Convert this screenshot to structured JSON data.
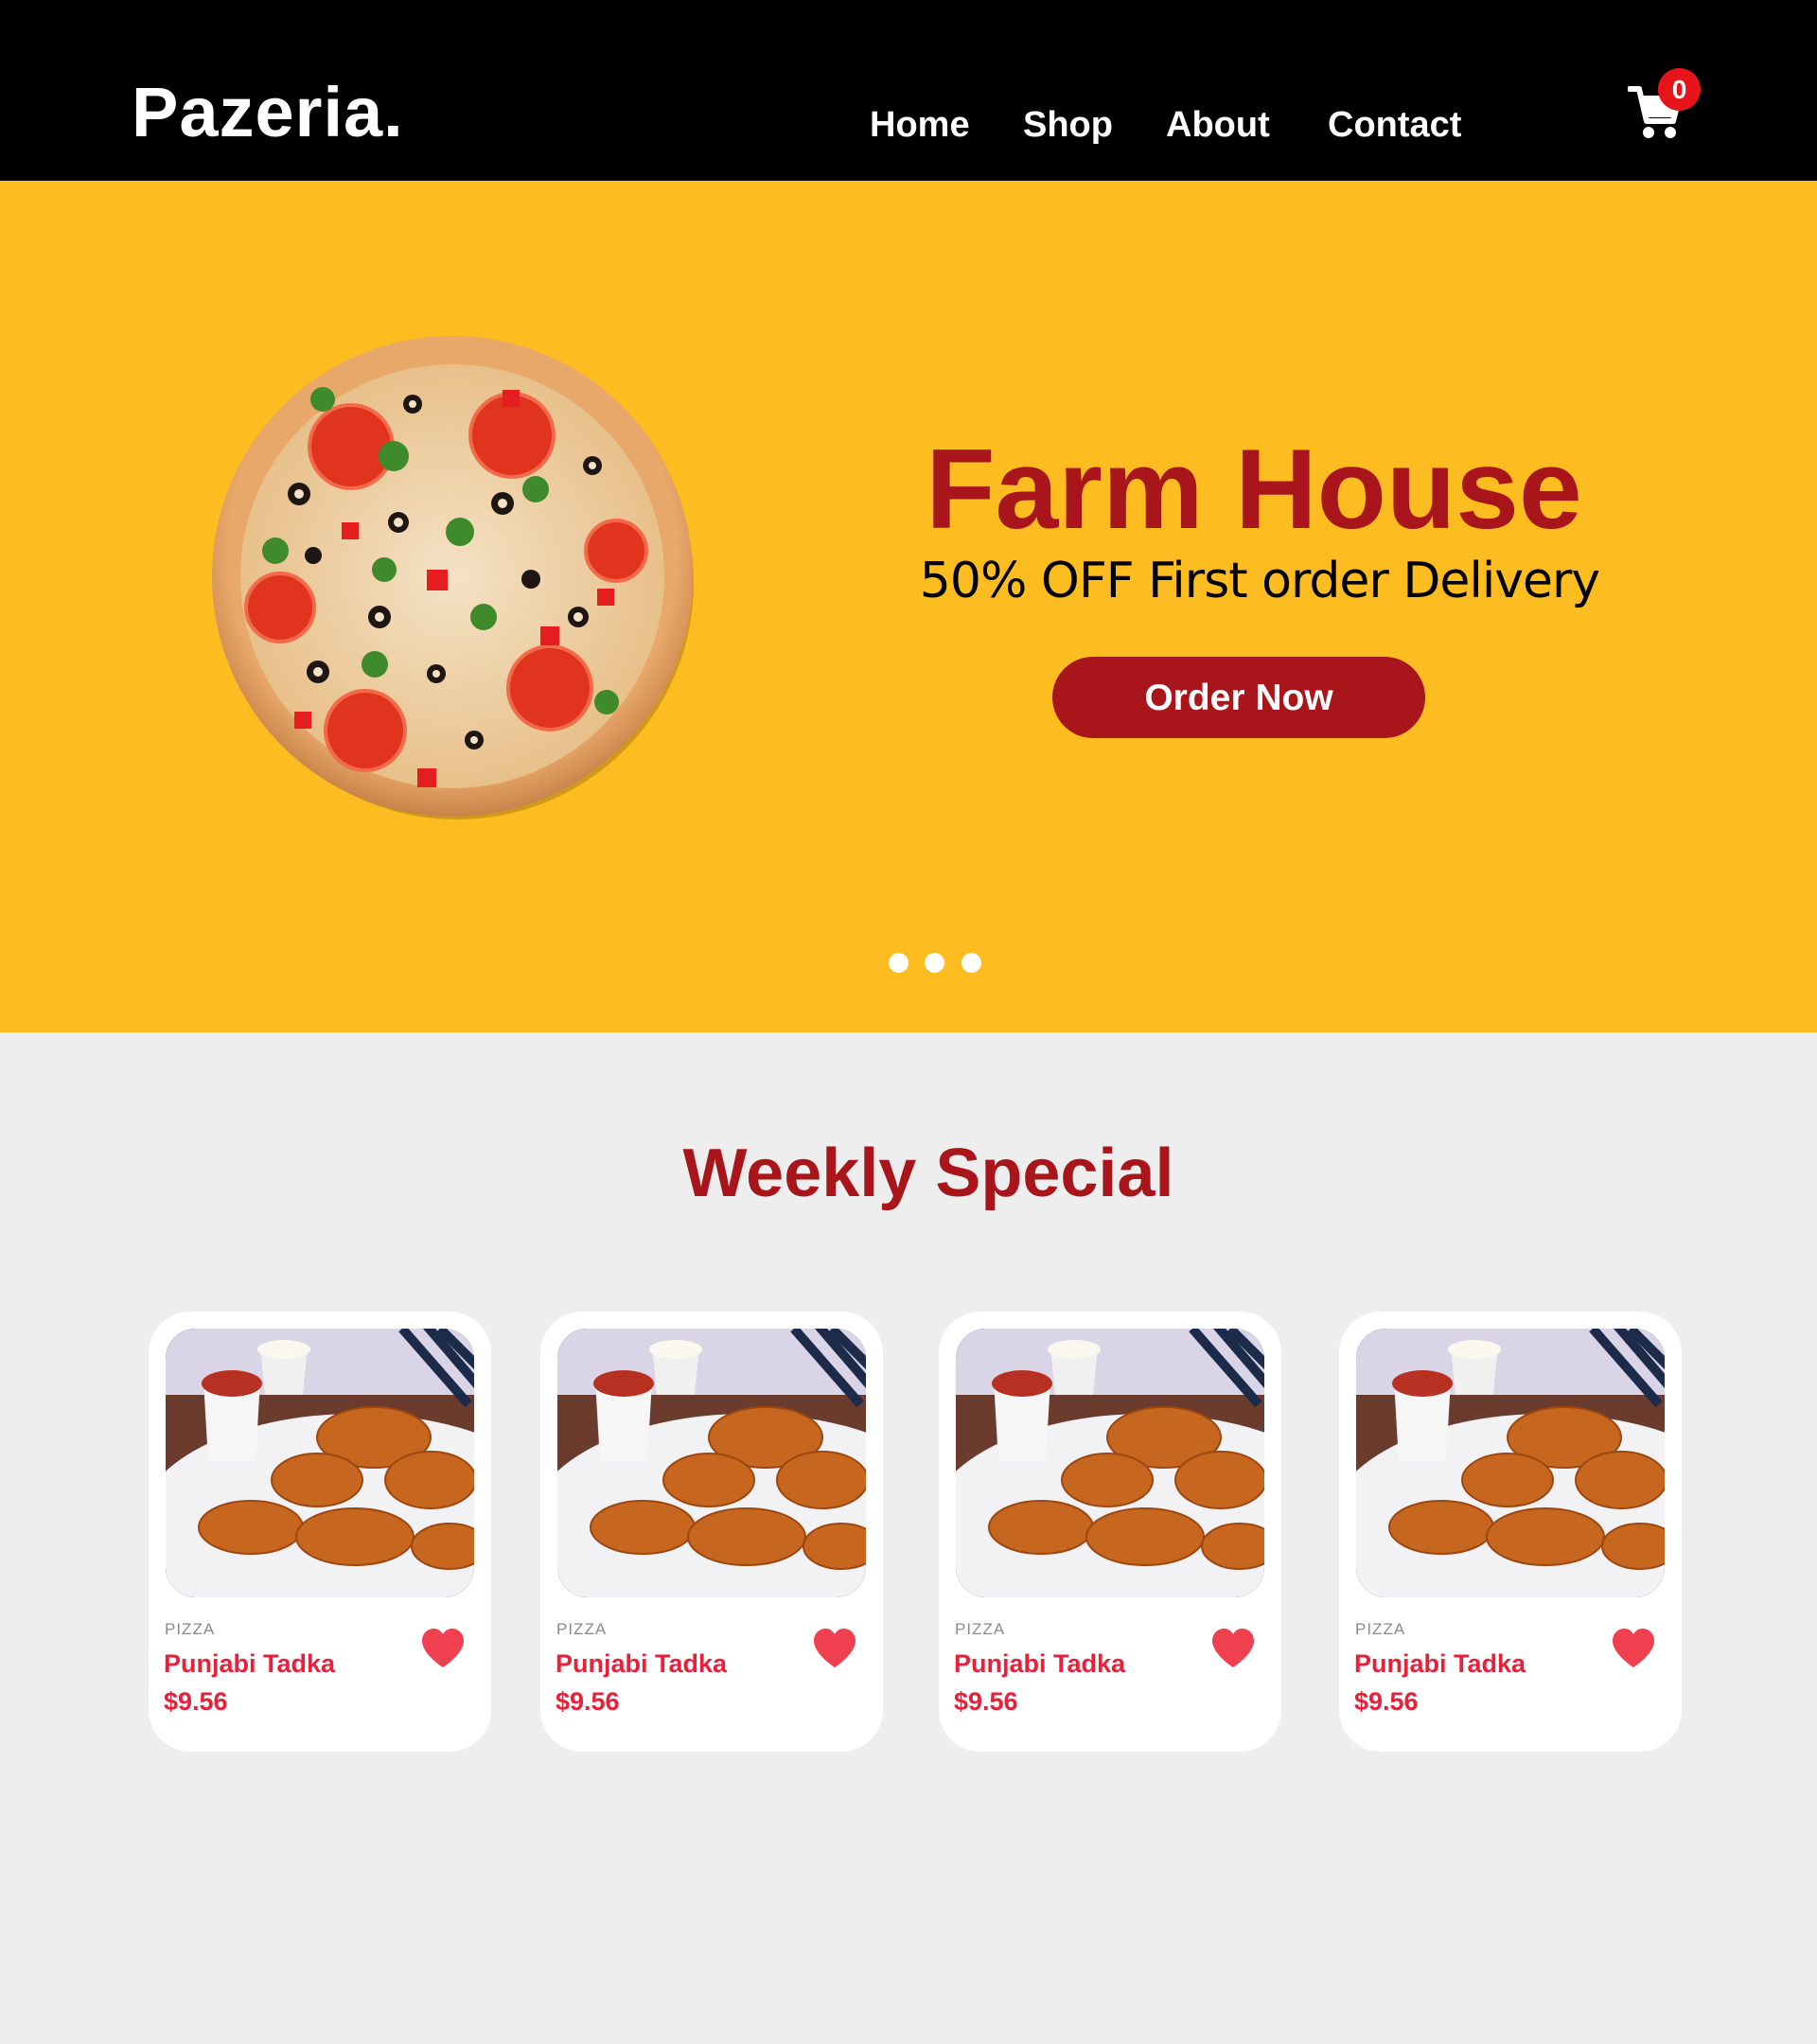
{
  "brand": {
    "logo": "Pazeria."
  },
  "nav": {
    "items": [
      "Home",
      "Shop",
      "About",
      "Contact"
    ]
  },
  "cart": {
    "icon": "cart-icon",
    "count": "0"
  },
  "hero": {
    "title": "Farm House",
    "subtitle": "50% OFF First order Delivery",
    "cta_label": "Order Now",
    "image": "pizza-image",
    "slides": 3
  },
  "weekly": {
    "title": "Weekly Special",
    "products": [
      {
        "category": "PIZZA",
        "name": "Punjabi Tadka",
        "price": "$9.56",
        "image": "chicken-nuggets-image",
        "favorite_icon": "heart-icon"
      },
      {
        "category": "PIZZA",
        "name": "Punjabi Tadka",
        "price": "$9.56",
        "image": "chicken-nuggets-image",
        "favorite_icon": "heart-icon"
      },
      {
        "category": "PIZZA",
        "name": "Punjabi Tadka",
        "price": "$9.56",
        "image": "chicken-nuggets-image",
        "favorite_icon": "heart-icon"
      },
      {
        "category": "PIZZA",
        "name": "Punjabi Tadka",
        "price": "$9.56",
        "image": "chicken-nuggets-image",
        "favorite_icon": "heart-icon"
      }
    ]
  },
  "colors": {
    "header_bg": "#000000",
    "hero_bg": "#fdbc1f",
    "accent": "#a8161c",
    "price": "#e8203a",
    "page_bg": "#eeeeee",
    "badge": "#e8141c",
    "heart": "#f04050"
  }
}
